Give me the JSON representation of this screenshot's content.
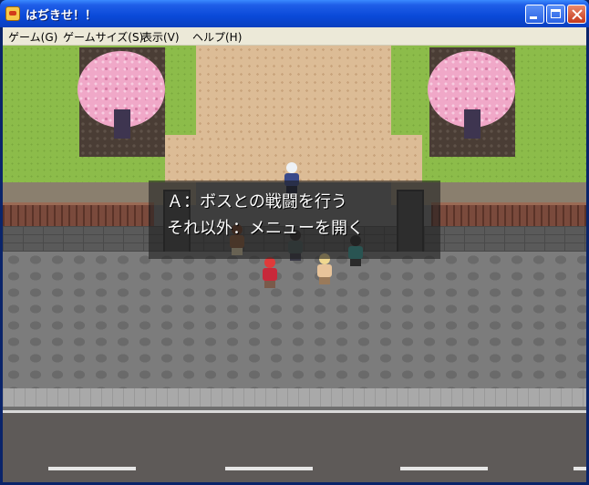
{
  "window": {
    "title": "はぢきせ！！"
  },
  "menubar": {
    "items": [
      {
        "label": "ゲーム(G)"
      },
      {
        "label": "ゲームサイズ(S)"
      },
      {
        "label": "表示(V)"
      },
      {
        "label": "ヘルプ(H)"
      }
    ]
  },
  "dialog": {
    "lines": [
      "Ａ：ボスとの戦闘を行う",
      "それ以外：メニューを開く"
    ]
  }
}
